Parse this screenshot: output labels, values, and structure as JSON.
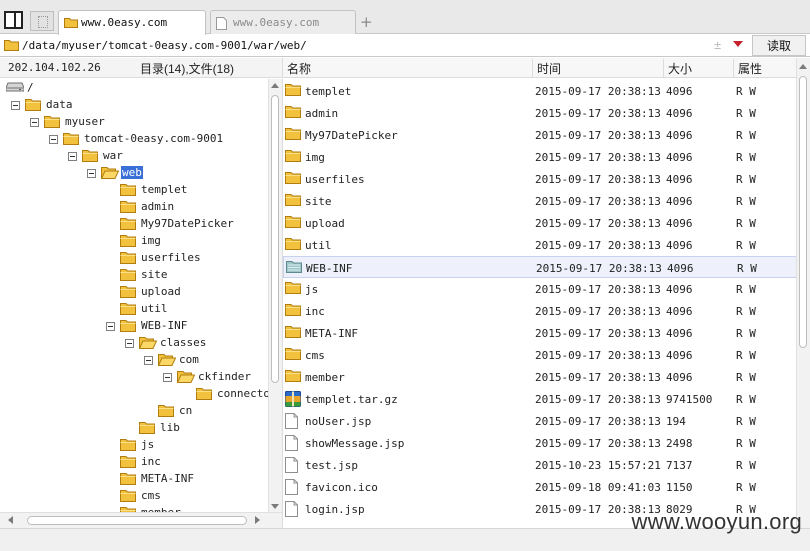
{
  "tabs": [
    {
      "label": "www.0easy.com",
      "active": true
    },
    {
      "label": "www.0easy.com",
      "active": false
    }
  ],
  "tab_add_label": "+",
  "address": {
    "path": "/data/myuser/tomcat-0easy.com-9001/war/web/",
    "updown_label": "±",
    "read_button": "读取"
  },
  "left_header": {
    "ip": "202.104.102.26",
    "count": "目录(14),文件(18)"
  },
  "tree": [
    {
      "label": "/",
      "level": 0,
      "icon": "drive-icon",
      "toggle": false,
      "selected": false
    },
    {
      "label": "data",
      "level": 0,
      "icon": "folder-icon",
      "toggle": true,
      "selected": false
    },
    {
      "label": "myuser",
      "level": 1,
      "icon": "folder-icon",
      "toggle": true,
      "selected": false
    },
    {
      "label": "tomcat-0easy.com-9001",
      "level": 2,
      "icon": "folder-icon",
      "toggle": true,
      "selected": false
    },
    {
      "label": "war",
      "level": 3,
      "icon": "folder-icon",
      "toggle": true,
      "selected": false
    },
    {
      "label": "web",
      "level": 4,
      "icon": "folder-open-icon",
      "toggle": true,
      "selected": true
    },
    {
      "label": "templet",
      "level": 5,
      "icon": "folder-icon",
      "toggle": false,
      "selected": false
    },
    {
      "label": "admin",
      "level": 5,
      "icon": "folder-icon",
      "toggle": false,
      "selected": false
    },
    {
      "label": "My97DatePicker",
      "level": 5,
      "icon": "folder-icon",
      "toggle": false,
      "selected": false
    },
    {
      "label": "img",
      "level": 5,
      "icon": "folder-icon",
      "toggle": false,
      "selected": false
    },
    {
      "label": "userfiles",
      "level": 5,
      "icon": "folder-icon",
      "toggle": false,
      "selected": false
    },
    {
      "label": "site",
      "level": 5,
      "icon": "folder-icon",
      "toggle": false,
      "selected": false
    },
    {
      "label": "upload",
      "level": 5,
      "icon": "folder-icon",
      "toggle": false,
      "selected": false
    },
    {
      "label": "util",
      "level": 5,
      "icon": "folder-icon",
      "toggle": false,
      "selected": false
    },
    {
      "label": "WEB-INF",
      "level": 5,
      "icon": "folder-icon",
      "toggle": true,
      "selected": false
    },
    {
      "label": "classes",
      "level": 6,
      "icon": "folder-open-icon",
      "toggle": true,
      "selected": false
    },
    {
      "label": "com",
      "level": 7,
      "icon": "folder-open-icon",
      "toggle": true,
      "selected": false
    },
    {
      "label": "ckfinder",
      "level": 8,
      "icon": "folder-open-icon",
      "toggle": true,
      "selected": false
    },
    {
      "label": "connector",
      "level": 9,
      "icon": "folder-icon",
      "toggle": false,
      "selected": false
    },
    {
      "label": "cn",
      "level": 7,
      "icon": "folder-icon",
      "toggle": false,
      "selected": false
    },
    {
      "label": "lib",
      "level": 6,
      "icon": "folder-icon",
      "toggle": false,
      "selected": false
    },
    {
      "label": "js",
      "level": 5,
      "icon": "folder-icon",
      "toggle": false,
      "selected": false
    },
    {
      "label": "inc",
      "level": 5,
      "icon": "folder-icon",
      "toggle": false,
      "selected": false
    },
    {
      "label": "META-INF",
      "level": 5,
      "icon": "folder-icon",
      "toggle": false,
      "selected": false
    },
    {
      "label": "cms",
      "level": 5,
      "icon": "folder-icon",
      "toggle": false,
      "selected": false
    },
    {
      "label": "member",
      "level": 5,
      "icon": "folder-icon",
      "toggle": false,
      "selected": false
    }
  ],
  "columns": [
    "名称",
    "时间",
    "大小",
    "属性"
  ],
  "files": [
    {
      "name": "templet",
      "time": "2015-09-17 20:38:13",
      "size": "4096",
      "perm": "R W",
      "icon": "folder-icon",
      "selected": false
    },
    {
      "name": "admin",
      "time": "2015-09-17 20:38:13",
      "size": "4096",
      "perm": "R W",
      "icon": "folder-icon",
      "selected": false
    },
    {
      "name": "My97DatePicker",
      "time": "2015-09-17 20:38:13",
      "size": "4096",
      "perm": "R W",
      "icon": "folder-icon",
      "selected": false
    },
    {
      "name": "img",
      "time": "2015-09-17 20:38:13",
      "size": "4096",
      "perm": "R W",
      "icon": "folder-icon",
      "selected": false
    },
    {
      "name": "userfiles",
      "time": "2015-09-17 20:38:13",
      "size": "4096",
      "perm": "R W",
      "icon": "folder-icon",
      "selected": false
    },
    {
      "name": "site",
      "time": "2015-09-17 20:38:13",
      "size": "4096",
      "perm": "R W",
      "icon": "folder-icon",
      "selected": false
    },
    {
      "name": "upload",
      "time": "2015-09-17 20:38:13",
      "size": "4096",
      "perm": "R W",
      "icon": "folder-icon",
      "selected": false
    },
    {
      "name": "util",
      "time": "2015-09-17 20:38:13",
      "size": "4096",
      "perm": "R W",
      "icon": "folder-icon",
      "selected": false
    },
    {
      "name": "WEB-INF",
      "time": "2015-09-17 20:38:13",
      "size": "4096",
      "perm": "R W",
      "icon": "folder-special-icon",
      "selected": true
    },
    {
      "name": "js",
      "time": "2015-09-17 20:38:13",
      "size": "4096",
      "perm": "R W",
      "icon": "folder-icon",
      "selected": false
    },
    {
      "name": "inc",
      "time": "2015-09-17 20:38:13",
      "size": "4096",
      "perm": "R W",
      "icon": "folder-icon",
      "selected": false
    },
    {
      "name": "META-INF",
      "time": "2015-09-17 20:38:13",
      "size": "4096",
      "perm": "R W",
      "icon": "folder-icon",
      "selected": false
    },
    {
      "name": "cms",
      "time": "2015-09-17 20:38:13",
      "size": "4096",
      "perm": "R W",
      "icon": "folder-icon",
      "selected": false
    },
    {
      "name": "member",
      "time": "2015-09-17 20:38:13",
      "size": "4096",
      "perm": "R W",
      "icon": "folder-icon",
      "selected": false
    },
    {
      "name": "templet.tar.gz",
      "time": "2015-09-17 20:38:13",
      "size": "9741500",
      "perm": "R W",
      "icon": "archive-icon",
      "selected": false
    },
    {
      "name": "noUser.jsp",
      "time": "2015-09-17 20:38:13",
      "size": "194",
      "perm": "R W",
      "icon": "file-icon",
      "selected": false
    },
    {
      "name": "showMessage.jsp",
      "time": "2015-09-17 20:38:13",
      "size": "2498",
      "perm": "R W",
      "icon": "file-icon",
      "selected": false
    },
    {
      "name": "test.jsp",
      "time": "2015-10-23 15:57:21",
      "size": "7137",
      "perm": "R W",
      "icon": "file-icon",
      "selected": false
    },
    {
      "name": "favicon.ico",
      "time": "2015-09-18 09:41:03",
      "size": "1150",
      "perm": "R W",
      "icon": "file-icon",
      "selected": false
    },
    {
      "name": "login.jsp",
      "time": "2015-09-17 20:38:13",
      "size": "8029",
      "perm": "R W",
      "icon": "file-icon",
      "selected": false
    }
  ],
  "watermark": "www.wooyun.org",
  "colors": {
    "selection": "#3a6fd8",
    "folder": "#f2c13d",
    "row_selected": "#eef1fb"
  }
}
